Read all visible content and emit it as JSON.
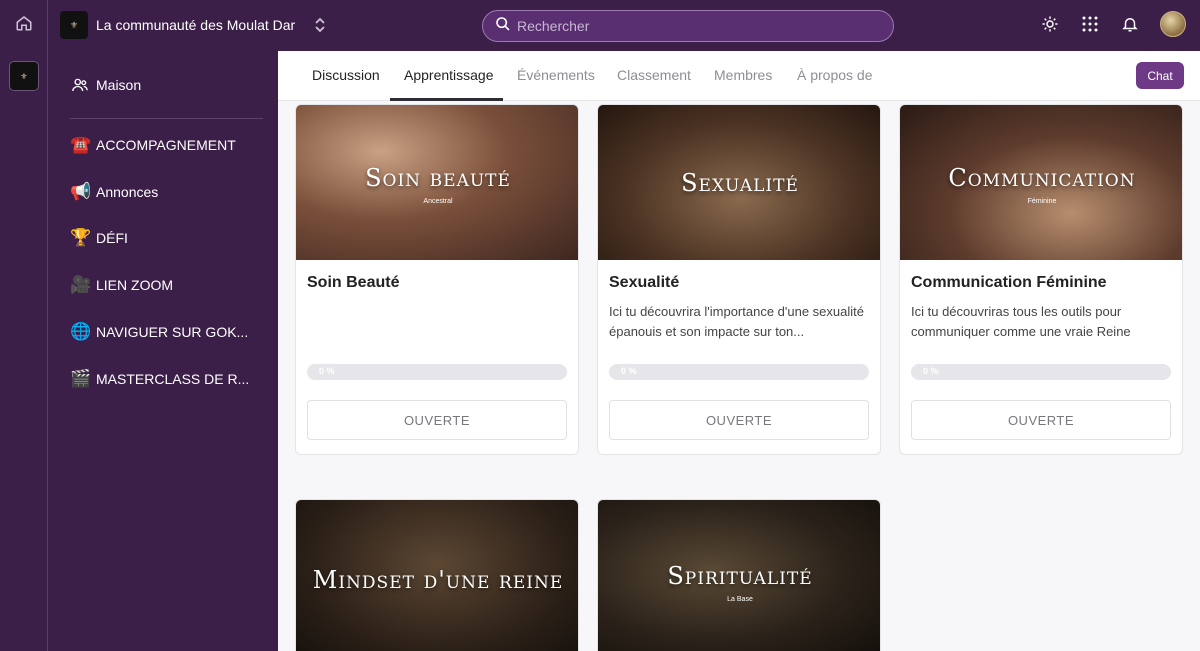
{
  "header": {
    "community_name": "La communauté des Moulat Dar",
    "search_placeholder": "Rechercher",
    "icons": [
      "home-icon",
      "chevron-updown-icon",
      "search-icon",
      "sun-icon",
      "grid-icon",
      "bell-icon"
    ]
  },
  "sidebar": {
    "items": [
      {
        "label": "Maison",
        "icon": "users-icon"
      },
      {
        "label": "ACCOMPAGNEMENT",
        "icon": "☎️"
      },
      {
        "label": "Annonces",
        "icon": "📢"
      },
      {
        "label": "DÉFI",
        "icon": "🏆"
      },
      {
        "label": "LIEN ZOOM",
        "icon": "🎥"
      },
      {
        "label": "NAVIGUER SUR GOK...",
        "icon": "🌐"
      },
      {
        "label": "MASTERCLASS DE R...",
        "icon": "🎬"
      }
    ]
  },
  "tabs": [
    {
      "label": "Discussion"
    },
    {
      "label": "Apprentissage"
    },
    {
      "label": "Événements"
    },
    {
      "label": "Classement"
    },
    {
      "label": "Membres"
    },
    {
      "label": "À propos de"
    }
  ],
  "chat_label": "Chat",
  "courses": [
    {
      "image_title": "Soin beauté",
      "image_subtitle": "Ancestral",
      "title": "Soin Beauté",
      "description": "",
      "progress_label": "0 %",
      "progress": 0,
      "button": "OUVERTE"
    },
    {
      "image_title": "Sexualité",
      "image_subtitle": "",
      "title": "Sexualité",
      "description": "Ici tu découvrira l'importance d'une sexualité épanouis et son impacte sur ton...",
      "progress_label": "0 %",
      "progress": 0,
      "button": "OUVERTE"
    },
    {
      "image_title": "Communication",
      "image_subtitle": "Féminine",
      "title": "Communication Féminine",
      "description": "Ici tu découvriras tous les outils pour communiquer comme une vraie Reine",
      "progress_label": "0 %",
      "progress": 0,
      "button": "OUVERTE"
    },
    {
      "image_title": "Mindset d'une reine",
      "image_subtitle": ""
    },
    {
      "image_title": "Spiritualité",
      "image_subtitle": "La Base"
    }
  ]
}
